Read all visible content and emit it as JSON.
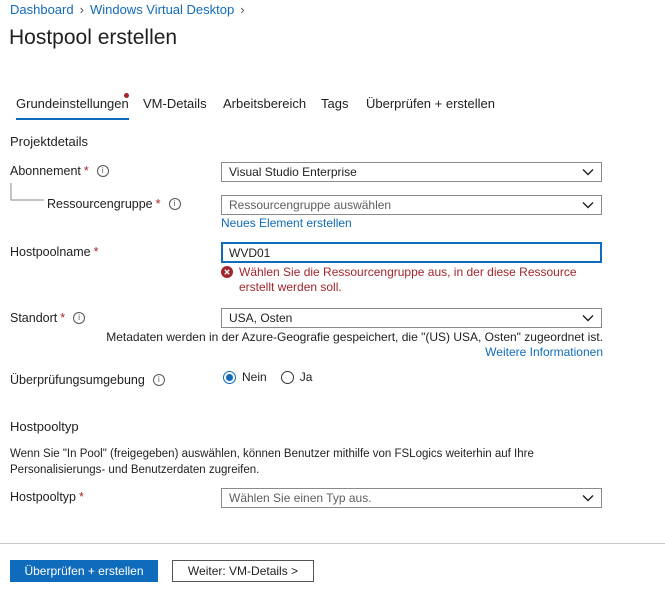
{
  "breadcrumb": {
    "items": [
      "Dashboard",
      "Windows Virtual Desktop"
    ]
  },
  "page": {
    "title": "Hostpool erstellen"
  },
  "tabs": [
    "Grundeinstellungen",
    "VM-Details",
    "Arbeitsbereich",
    "Tags",
    "Überprüfen + erstellen"
  ],
  "projekt": {
    "heading": "Projektdetails",
    "abonnement_label": "Abonnement",
    "abonnement_value": "Visual Studio Enterprise",
    "rg_label": "Ressourcengruppe",
    "rg_placeholder": "Ressourcengruppe auswählen",
    "rg_new_link": "Neues Element erstellen"
  },
  "hostpoolname": {
    "label": "Hostpoolname",
    "value": "WVD01",
    "error": "Wählen Sie die Ressourcengruppe aus, in der diese Ressource erstellt werden soll."
  },
  "standort": {
    "label": "Standort",
    "value": "USA, Osten",
    "note": "Metadaten werden in der Azure-Geografie gespeichert, die \"(US) USA, Osten\" zugeordnet ist.",
    "more_link": "Weitere Informationen"
  },
  "validation": {
    "label": "Überprüfungsumgebung",
    "options": [
      "Nein",
      "Ja"
    ],
    "selected": "Nein"
  },
  "hostpooltyp": {
    "heading": "Hostpooltyp",
    "description": "Wenn Sie \"In Pool\" (freigegeben) auswählen, können Benutzer mithilfe von FSLogics weiterhin auf Ihre Personalisierungs- und Benutzerdaten zugreifen.",
    "label": "Hostpooltyp",
    "placeholder": "Wählen Sie einen Typ aus."
  },
  "footer": {
    "primary_label": "Überprüfen + erstellen",
    "secondary_label": "Weiter: VM-Details >"
  },
  "common": {
    "required_mark": "*",
    "info_glyph": "i"
  },
  "colors": {
    "accent": "#0f6cbd",
    "error": "#a4262c"
  }
}
